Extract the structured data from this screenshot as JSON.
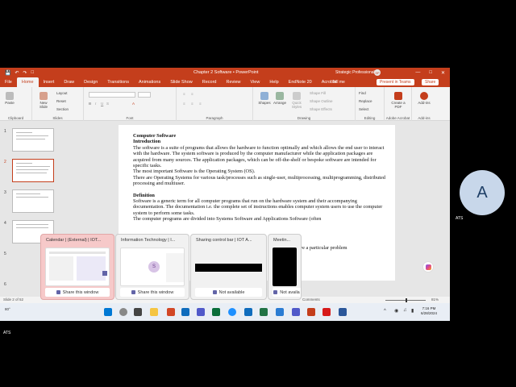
{
  "titlebar": {
    "autosave": "AutoSave",
    "save_icon": "save-icon",
    "title": "Chapter 2 Software • PowerPoint",
    "user": "Strategic Professional",
    "avatar_initials": "SP"
  },
  "tabs": [
    "File",
    "Home",
    "Insert",
    "Draw",
    "Design",
    "Transitions",
    "Animations",
    "Slide Show",
    "Record",
    "Review",
    "View",
    "Help",
    "EndNote 20",
    "Acrobat"
  ],
  "active_tab": "Home",
  "tell_me": "Tell me",
  "present_in_teams": "Present in Teams",
  "share": "Share",
  "ribbon": {
    "clipboard": {
      "label": "Clipboard",
      "paste": "Paste"
    },
    "slides": {
      "label": "Slides",
      "new_slide": "New Slide",
      "layout": "Layout",
      "reset": "Reset",
      "section": "Section"
    },
    "font": {
      "label": "Font"
    },
    "paragraph": {
      "label": "Paragraph"
    },
    "drawing": {
      "label": "Drawing",
      "shapes": "Shapes",
      "arrange": "Arrange",
      "quick_styles": "Quick Styles",
      "shape_fill": "Shape Fill",
      "shape_outline": "Shape Outline",
      "shape_effects": "Shape Effects"
    },
    "editing": {
      "label": "Editing",
      "find": "Find",
      "replace": "Replace",
      "select": "Select"
    },
    "adobe": {
      "label": "Adobe Acrobat",
      "create_pdf": "Create a PDF"
    },
    "addins": {
      "label": "Add-ins",
      "addins_btn": "Add-ins"
    }
  },
  "thumbnails": [
    {
      "num": "1"
    },
    {
      "num": "2"
    },
    {
      "num": "3"
    },
    {
      "num": "4"
    },
    {
      "num": "5"
    },
    {
      "num": "6"
    }
  ],
  "slide": {
    "heading1": "Computer Software",
    "heading2": "Introduction",
    "para1": "The software is a suite of programs that allows the hardware to function optimally and which allows the end user to interact with the hardware. The system software is produced by the computer manufacturer while the application packages are acquired from many sources. The application packages, which can be off-the-shelf or bespoke software are intended for specific tasks.",
    "line2": "The most important Software is the Operating System (OS).",
    "line3": "There are Operating Systems for various task/processes such as single-user, multiprocessing, multiprogramming, distributed processing and multiuser.",
    "heading3": "Definition",
    "para2": "Software is a generic term for all computer programs that run on the hardware system and their accompanying documentation. The documentation i.e. the complete set of instructions enables computer system users to use the computer system to perform some tasks.",
    "para3_partial": "The computer programs are divided into Systems Software and Applications Software (often",
    "tail_text": "ve a particular problem"
  },
  "statusbar": {
    "slide_info": "Slide 2 of 52",
    "comments": "Comments",
    "zoom": "81%"
  },
  "taskbar": {
    "weather": "80°",
    "time": "7:16 PM",
    "date": "6/28/2024"
  },
  "previews": [
    {
      "title": "Calendar | (External) | IOT...",
      "button": "Share this window"
    },
    {
      "title": "Information Technology | I...",
      "button": "Share this window",
      "avatar": "S"
    },
    {
      "title": "Sharing control bar | IOT A...",
      "button": "Not available"
    },
    {
      "title": "Meetin...",
      "button": "Not availa"
    }
  ],
  "side_avatar": "A",
  "side_label": "ATS",
  "bottom_label": "ATS"
}
